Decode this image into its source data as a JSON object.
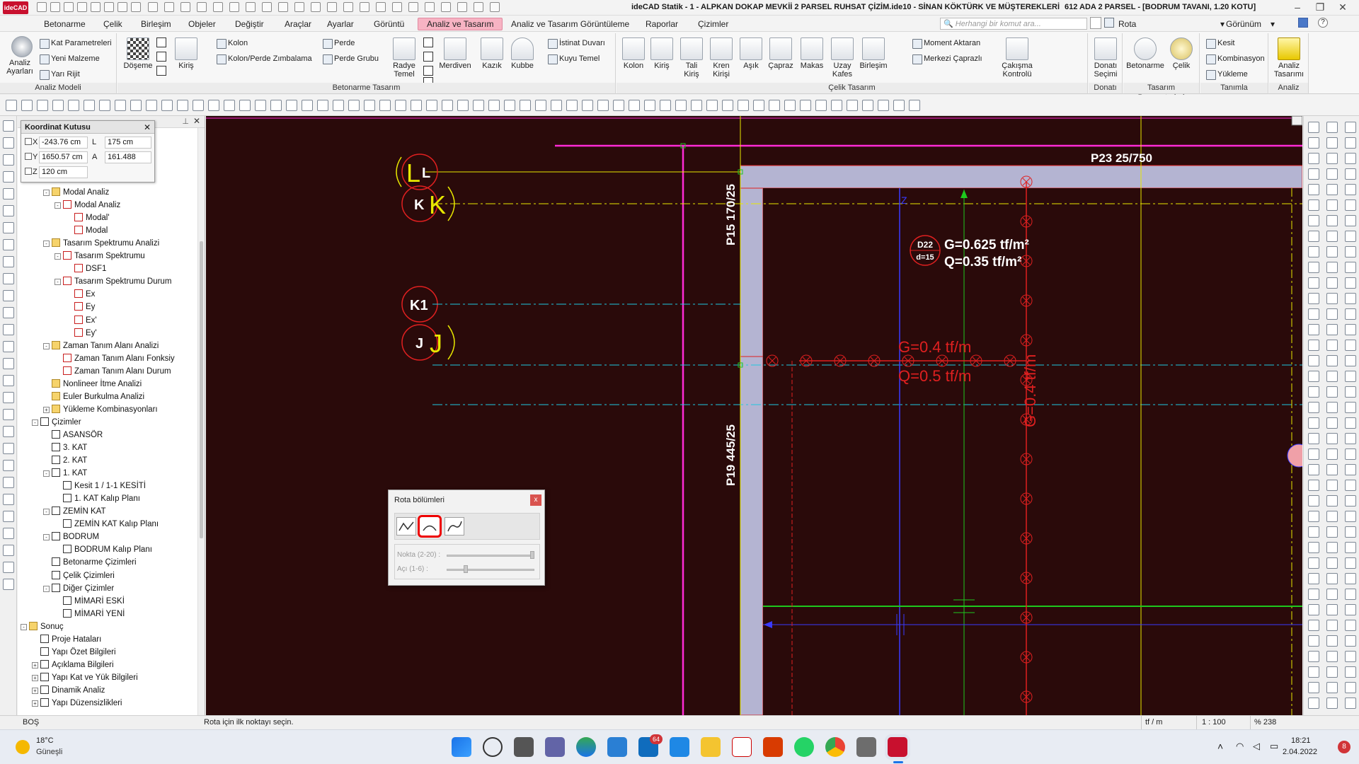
{
  "window": {
    "title": "ideCAD Statik - 1 - ALPKAN DOKAP MEVKİİ 2 PARSEL RUHSAT ÇİZİM.ide10 - SİNAN KÖKTÜRK VE MÜŞTEREKLERİ",
    "context": "612 ADA 2 PARSEL - [BODRUM TAVANI,  1.20 KOTU]",
    "logo": "ideCAD"
  },
  "menu": {
    "items": [
      "Betonarme",
      "Çelik",
      "Birleşim",
      "Objeler",
      "Değiştir",
      "Araçlar",
      "Ayarlar",
      "Görüntü",
      "Analiz ve Tasarım",
      "Analiz ve Tasarım Görüntüleme",
      "Raporlar",
      "Çizimler"
    ],
    "active": "Analiz ve Tasarım",
    "command_placeholder": "Herhangi bir komut ara...",
    "rota": "Rota",
    "gorunum": "Görünüm"
  },
  "ribbon": {
    "analiz_modeli": {
      "label": "Analiz Modeli",
      "analiz_ayarlari": "Analiz Ayarları",
      "kat_parametreleri": "Kat Parametreleri",
      "yeni_malzeme": "Yeni Malzeme",
      "yari_rijit": "Yarı Rijit"
    },
    "betonarme_tasarim": {
      "label": "Betonarme Tasarım",
      "doseme": "Döşeme",
      "kiris": "Kiriş",
      "kolon": "Kolon",
      "kolon_perde_zimbalama": "Kolon/Perde Zımbalama",
      "perde": "Perde",
      "perde_grubu": "Perde Grubu",
      "radye_temel": "Radye Temel",
      "merdiven": "Merdiven",
      "kazik": "Kazık",
      "kubbe": "Kubbe",
      "istinat_duvari": "İstinat Duvarı",
      "kuyu_temel": "Kuyu Temel"
    },
    "celik_tasarim": {
      "label": "Çelik Tasarım",
      "kolon": "Kolon",
      "kiris": "Kiriş",
      "tali_kiris": "Tali Kiriş",
      "kren_kirisi": "Kren Kirişi",
      "asik": "Aşık",
      "capraz": "Çapraz",
      "makas": "Makas",
      "uzay_kafes": "Uzay Kafes",
      "birlesim": "Birleşim",
      "moment_aktaran": "Moment Aktaran",
      "merkezi_caprazli": "Merkezi Çaprazlı",
      "cakisma_kontrolu": "Çakışma Kontrolü"
    },
    "donati": {
      "label": "Donatı",
      "donati_secimi": "Donatı Seçimi"
    },
    "tasarim_parametreleri": {
      "label": "Tasarım Parametreleri",
      "betonarme": "Betonarme",
      "celik": "Çelik"
    },
    "tanimla": {
      "label": "Tanımla",
      "kesit": "Kesit",
      "kombinasyon": "Kombinasyon",
      "yukleme": "Yükleme"
    },
    "analiz": {
      "label": "Analiz",
      "analiz_tasarimi": "Analiz Tasarımı"
    }
  },
  "coord_box": {
    "title": "Koordinat Kutusu",
    "x_label": "X",
    "x_val": "-243.76 cm",
    "y_label": "Y",
    "y_val": "1650.57 cm",
    "z_label": "Z",
    "z_val": "120 cm",
    "l_label": "L",
    "l_val": "175 cm",
    "a_label": "A",
    "a_val": "161.488"
  },
  "tree": {
    "items": [
      {
        "label": "Modal Analiz",
        "lvl": 2,
        "exp": "-",
        "icon": "folder"
      },
      {
        "label": "Modal Analiz",
        "lvl": 3,
        "exp": "-",
        "icon": "red"
      },
      {
        "label": "Modal'",
        "lvl": 4,
        "exp": "",
        "icon": "red"
      },
      {
        "label": "Modal",
        "lvl": 4,
        "exp": "",
        "icon": "red"
      },
      {
        "label": "Tasarım Spektrumu Analizi",
        "lvl": 2,
        "exp": "-",
        "icon": "folder"
      },
      {
        "label": "Tasarım Spektrumu",
        "lvl": 3,
        "exp": "-",
        "icon": "red"
      },
      {
        "label": "DSF1",
        "lvl": 4,
        "exp": "",
        "icon": "red"
      },
      {
        "label": "Tasarım Spektrumu Durum",
        "lvl": 3,
        "exp": "-",
        "icon": "red"
      },
      {
        "label": "Ex",
        "lvl": 4,
        "exp": "",
        "icon": "red"
      },
      {
        "label": "Ey",
        "lvl": 4,
        "exp": "",
        "icon": "red"
      },
      {
        "label": "Ex'",
        "lvl": 4,
        "exp": "",
        "icon": "red"
      },
      {
        "label": "Ey'",
        "lvl": 4,
        "exp": "",
        "icon": "red"
      },
      {
        "label": "Zaman Tanım Alanı Analizi",
        "lvl": 2,
        "exp": "-",
        "icon": "folder"
      },
      {
        "label": "Zaman Tanım Alanı Fonksiy",
        "lvl": 3,
        "exp": "",
        "icon": "red"
      },
      {
        "label": "Zaman Tanım Alanı Durum",
        "lvl": 3,
        "exp": "",
        "icon": "red"
      },
      {
        "label": "Nonlineer İtme Analizi",
        "lvl": 2,
        "exp": "",
        "icon": "folder"
      },
      {
        "label": "Euler Burkulma Analizi",
        "lvl": 2,
        "exp": "",
        "icon": "folder"
      },
      {
        "label": "Yükleme Kombinasyonları",
        "lvl": 2,
        "exp": "+",
        "icon": "folder"
      },
      {
        "label": "Çizimler",
        "lvl": 1,
        "exp": "-",
        "icon": "plain"
      },
      {
        "label": "ASANSÖR",
        "lvl": 2,
        "exp": "",
        "icon": "plain"
      },
      {
        "label": "3. KAT",
        "lvl": 2,
        "exp": "",
        "icon": "plain"
      },
      {
        "label": "2. KAT",
        "lvl": 2,
        "exp": "",
        "icon": "plain"
      },
      {
        "label": "1. KAT",
        "lvl": 2,
        "exp": "-",
        "icon": "plain"
      },
      {
        "label": "Kesit 1 / 1-1 KESİTİ",
        "lvl": 3,
        "exp": "",
        "icon": "plain"
      },
      {
        "label": "1. KAT Kalıp Planı",
        "lvl": 3,
        "exp": "",
        "icon": "plain"
      },
      {
        "label": "ZEMİN KAT",
        "lvl": 2,
        "exp": "-",
        "icon": "plain"
      },
      {
        "label": "ZEMİN KAT Kalıp Planı",
        "lvl": 3,
        "exp": "",
        "icon": "plain"
      },
      {
        "label": "BODRUM",
        "lvl": 2,
        "exp": "-",
        "icon": "plain"
      },
      {
        "label": "BODRUM Kalıp Planı",
        "lvl": 3,
        "exp": "",
        "icon": "plain"
      },
      {
        "label": "Betonarme Çizimleri",
        "lvl": 2,
        "exp": "",
        "icon": "plain"
      },
      {
        "label": "Çelik Çizimleri",
        "lvl": 2,
        "exp": "",
        "icon": "plain"
      },
      {
        "label": "Diğer Çizimler",
        "lvl": 2,
        "exp": "-",
        "icon": "plain"
      },
      {
        "label": "MİMARİ ESKİ",
        "lvl": 3,
        "exp": "",
        "icon": "plain"
      },
      {
        "label": "MİMARİ YENİ",
        "lvl": 3,
        "exp": "",
        "icon": "plain"
      },
      {
        "label": "Sonuç",
        "lvl": 0,
        "exp": "-",
        "icon": "folder"
      },
      {
        "label": "Proje Hataları",
        "lvl": 1,
        "exp": "",
        "icon": "plain"
      },
      {
        "label": "Yapı Özet Bilgileri",
        "lvl": 1,
        "exp": "",
        "icon": "plain"
      },
      {
        "label": "Açıklama Bilgileri",
        "lvl": 1,
        "exp": "+",
        "icon": "plain"
      },
      {
        "label": "Yapı Kat ve Yük Bilgileri",
        "lvl": 1,
        "exp": "+",
        "icon": "plain"
      },
      {
        "label": "Dinamik Analiz",
        "lvl": 1,
        "exp": "+",
        "icon": "plain"
      },
      {
        "label": "Yapı Düzensizlikleri",
        "lvl": 1,
        "exp": "+",
        "icon": "plain"
      }
    ]
  },
  "drawing": {
    "axis_L": "L",
    "axis_K": "K",
    "axis_K1": "K1",
    "axis_J": "J",
    "beam_p23": "P23 25/750",
    "wall_p15": "P15 170/25",
    "wall_p19": "P19 445/25",
    "slab_id": "D22",
    "slab_thk": "d=15",
    "slab_g": "G=0.625 tf/m²",
    "slab_q": "Q=0.35 tf/m²",
    "line_g": "G=0.4  tf/m",
    "line_q": "Q=0.5  tf/m",
    "vert_g": "G=0.4  tf/m",
    "z_mark": "Z"
  },
  "rota_dialog": {
    "title": "Rota bölümleri",
    "close": "x",
    "nokta_label": "Nokta (2-20) :",
    "aci_label": "Açı (1-6) :",
    "nokta_value": 20,
    "aci_value": 2
  },
  "status": {
    "mode": "BOŞ",
    "prompt": "Rota için ilk noktayı seçin.",
    "unit": "tf / m",
    "scale": "1 : 100",
    "zoom": "% 238"
  },
  "taskbar": {
    "temp": "18°C",
    "weather": "Güneşli",
    "time": "18:21",
    "date": "2.04.2022",
    "mail_badge": "64",
    "notif_badge": "8"
  },
  "colors": {
    "canvas": "#2a0a0a",
    "magenta": "#ff2bd6",
    "yellow": "#e8e800",
    "cyan": "#1fc8e0",
    "red": "#e02020",
    "green": "#1ec81e",
    "blue": "#3a3aff",
    "wall": "#b4b4d2",
    "menu_active": "#f7b3c3"
  }
}
